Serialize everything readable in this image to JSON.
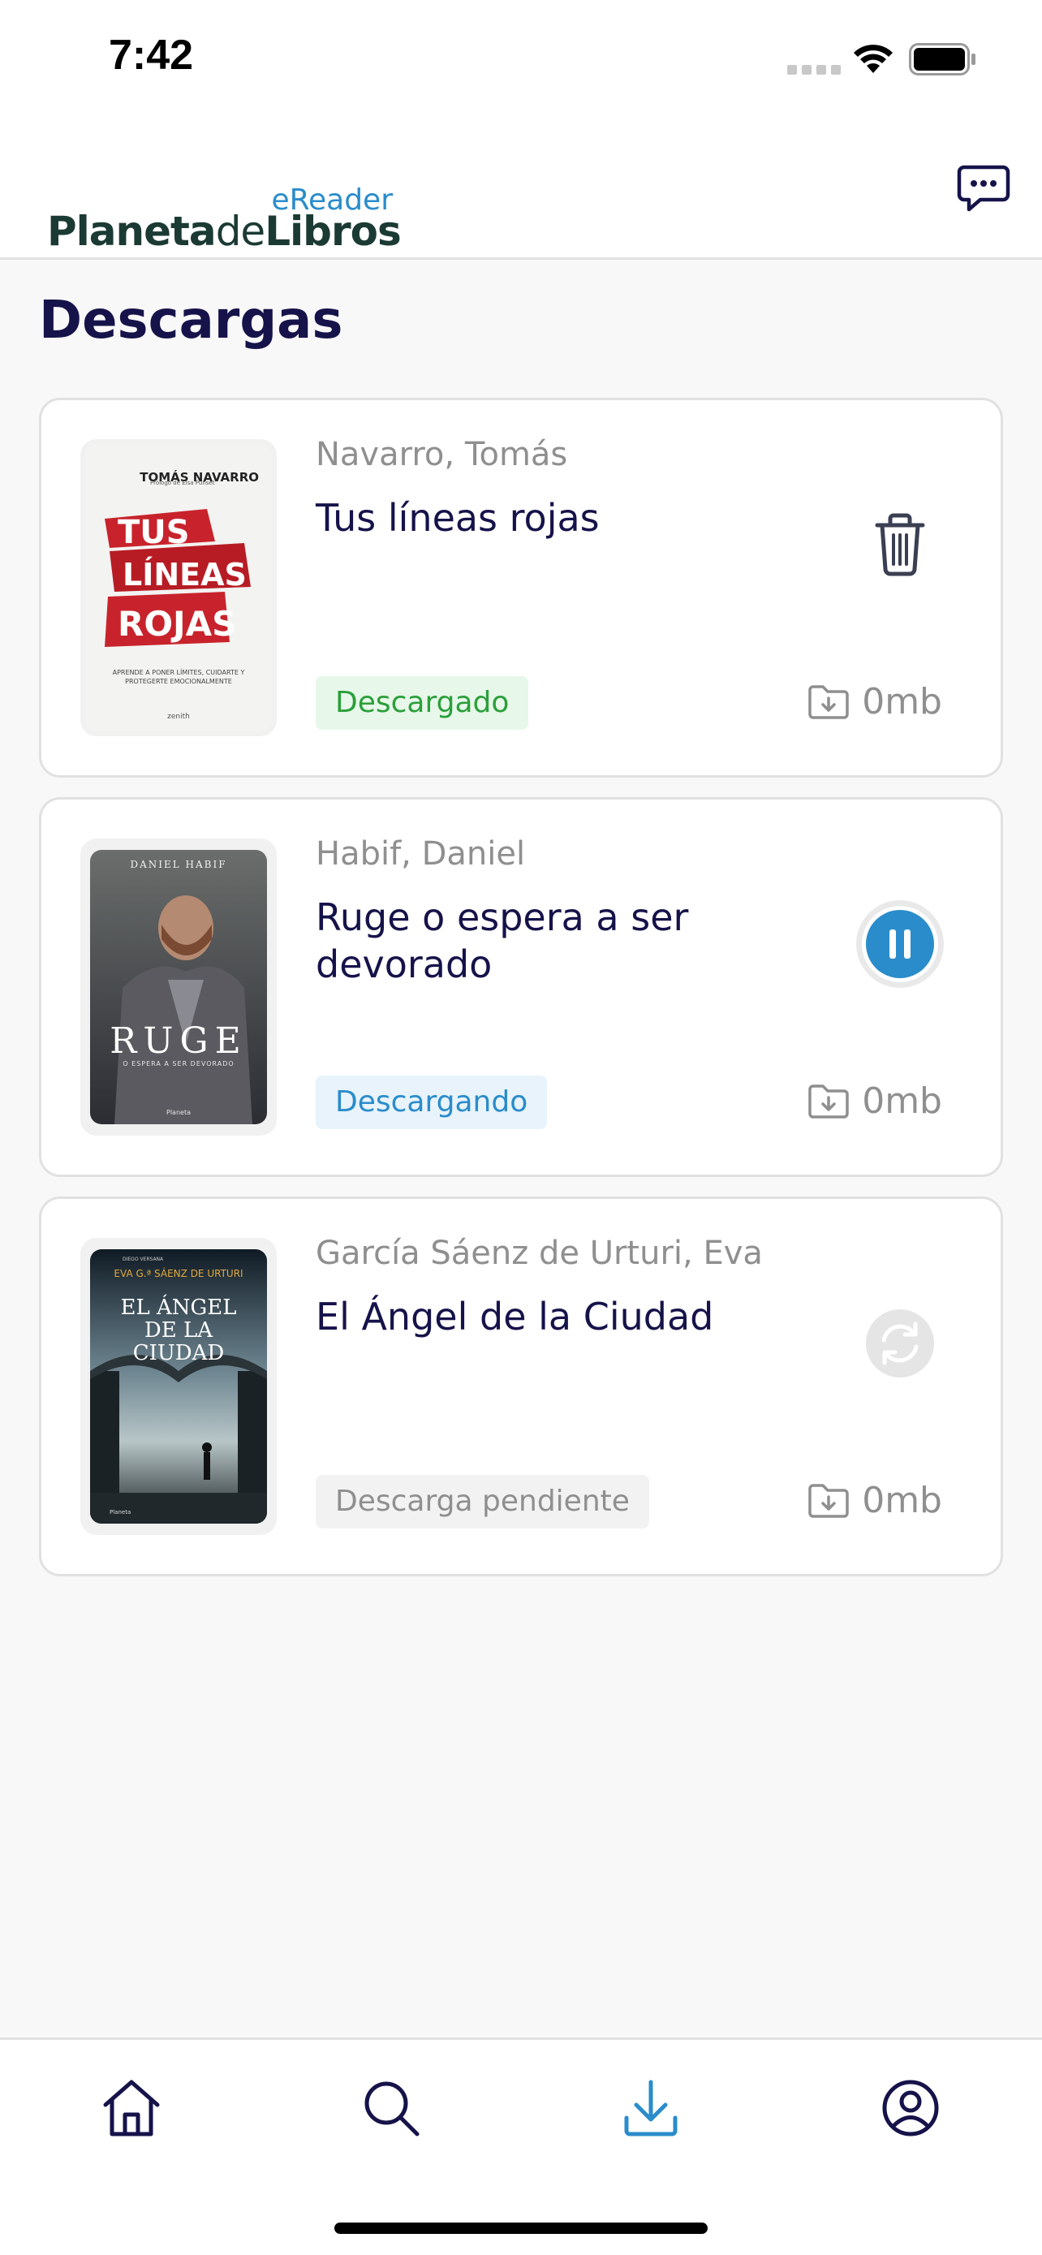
{
  "status_bar": {
    "time": "7:42"
  },
  "header": {
    "logo_sub": "eReader",
    "logo_part1": "Planeta",
    "logo_part2": "de",
    "logo_part3": "Libros"
  },
  "page_title": "Descargas",
  "downloads": [
    {
      "author": "Navarro, Tomás",
      "title": "Tus líneas rojas",
      "status": "Descargado",
      "size": "0mb",
      "action": "trash-icon",
      "cover": {
        "author": "TOMÁS NAVARRO",
        "prologue": "Prólogo de Elsa Punset",
        "words": [
          "TUS",
          "LÍNEAS",
          "ROJAS"
        ],
        "subtitle": "APRENDE A PONER LÍMITES, CUIDARTE Y PROTEGERTE EMOCIONALMENTE",
        "publisher": "zenith"
      }
    },
    {
      "author": "Habif, Daniel",
      "title": "Ruge o espera a ser devorado",
      "status": "Descargando",
      "size": "0mb",
      "action": "pause-icon",
      "cover": {
        "author": "DANIEL HABIF",
        "title": "RUGE",
        "subtitle": "O ESPERA A SER DEVORADO",
        "publisher": "Planeta"
      }
    },
    {
      "author": "García Sáenz de Urturi, Eva",
      "title": "El Ángel de la Ciudad",
      "status": "Descarga pendiente",
      "size": "0mb",
      "action": "retry-icon",
      "cover": {
        "series": "DIEGO VERSANA",
        "author": "EVA G.ª SÁENZ DE URTURI",
        "title": [
          "EL ÁNGEL",
          "DE LA",
          "CIUDAD"
        ],
        "publisher": "Planeta"
      }
    }
  ],
  "tabbar": {
    "active": "downloads",
    "accent": "#2a8ccb",
    "inactive": "#16134a"
  }
}
